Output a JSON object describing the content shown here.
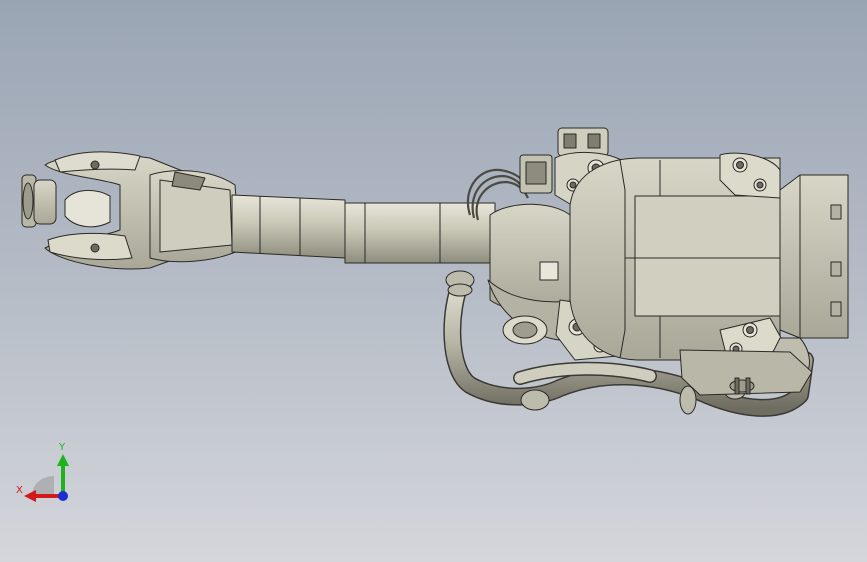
{
  "viewport": {
    "background_top": "#9aa5b4",
    "background_bottom": "#d4d6db",
    "model_color": "#c6c4b3",
    "model_edge": "#2a2a26"
  },
  "triad": {
    "x_label": "X",
    "y_label": "Y",
    "x_color": "#d21a1a",
    "y_color": "#1db31d",
    "z_color": "#1a2fd2"
  }
}
